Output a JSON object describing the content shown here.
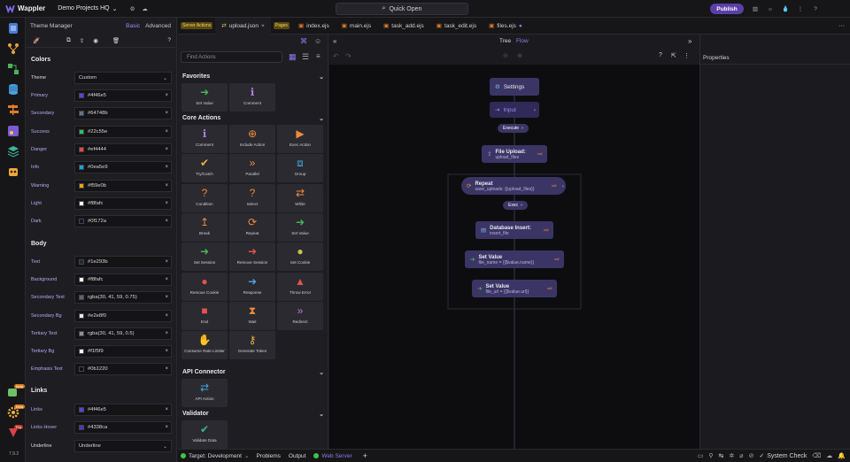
{
  "app": {
    "name": "Wappler",
    "project": "Demo Projects HQ",
    "quick_open": "Quick Open",
    "publish": "Publish",
    "version": "7.9.2"
  },
  "rail": {
    "badges": [
      "Beta",
      "Beta",
      "Pro"
    ]
  },
  "theme": {
    "title": "Theme Manager",
    "mode_basic": "Basic",
    "mode_advanced": "Advanced",
    "sections": {
      "colors": "Colors",
      "body": "Body",
      "links": "Links"
    },
    "theme_label": "Theme",
    "theme_value": "Custom",
    "colors": [
      {
        "label": "Primary",
        "value": "#4f46e5",
        "swatch": "#4f46e5"
      },
      {
        "label": "Secondary",
        "value": "#64748b",
        "swatch": "#64748b"
      },
      {
        "label": "Success",
        "value": "#22c55e",
        "swatch": "#22c55e"
      },
      {
        "label": "Danger",
        "value": "#ef4444",
        "swatch": "#ef4444"
      },
      {
        "label": "Info",
        "value": "#0ea5e9",
        "swatch": "#0ea5e9"
      },
      {
        "label": "Warning",
        "value": "#f59e0b",
        "swatch": "#f59e0b"
      },
      {
        "label": "Light",
        "value": "#f8fafc",
        "swatch": "#f8fafc"
      },
      {
        "label": "Dark",
        "value": "#0f172a",
        "swatch": "#0f172a"
      }
    ],
    "body": [
      {
        "label": "Text",
        "value": "#1e293b",
        "swatch": "#1e293b"
      },
      {
        "label": "Background",
        "value": "#f8fafc",
        "swatch": "#f8fafc"
      },
      {
        "label": "Secondary Text",
        "value": "rgba(30, 41, 59, 0.75)",
        "swatch": "#5b6478"
      },
      {
        "label": "Secondary Bg",
        "value": "#e2e8f0",
        "swatch": "#e2e8f0"
      },
      {
        "label": "Tertiary Text",
        "value": "rgba(30, 41, 59, 0.5)",
        "swatch": "#8a91a0"
      },
      {
        "label": "Tertiary Bg",
        "value": "#f1f5f9",
        "swatch": "#f1f5f9"
      },
      {
        "label": "Emphasis Text",
        "value": "#0b1220",
        "swatch": "#0b1220"
      }
    ],
    "links": [
      {
        "label": "Links",
        "value": "#4f46e5",
        "swatch": "#4f46e5"
      },
      {
        "label": "Links Hover",
        "value": "#4338ca",
        "swatch": "#4338ca"
      }
    ],
    "underline_label": "Underline",
    "underline_value": "Underline"
  },
  "tabs": [
    {
      "tag": "Server Actions",
      "label": ""
    },
    {
      "tag": "",
      "label": "upload.json"
    },
    {
      "tag": "Pages",
      "label": ""
    },
    {
      "tag": "",
      "label": "index.ejs"
    },
    {
      "tag": "",
      "label": "main.ejs"
    },
    {
      "tag": "",
      "label": "task_add.ejs"
    },
    {
      "tag": "",
      "label": "task_edit.ejs"
    },
    {
      "tag": "",
      "label": "files.ejs"
    }
  ],
  "actions": {
    "search_placeholder": "Find Actions",
    "groups": {
      "favorites": "Favorites",
      "core": "Core Actions",
      "api": "API Connector",
      "validator": "Validator"
    },
    "favorites": [
      "Set Value",
      "Comment"
    ],
    "core": [
      "Comment",
      "Include Action",
      "Exec Action",
      "Try/Catch",
      "Parallel",
      "Group",
      "Condition",
      "Select",
      "While",
      "Break",
      "Repeat",
      "Set Value",
      "Set Session",
      "Remove Session",
      "Set Cookie",
      "Remove Cookie",
      "Response",
      "Throw Error",
      "End",
      "Wait",
      "Redirect",
      "Consume Rate Limiter",
      "Generate Token"
    ],
    "api": [
      "API Action"
    ],
    "validator": [
      "Validate Data"
    ]
  },
  "canvas": {
    "view_tree": "Tree",
    "view_flow": "Flow",
    "settings": "Settings",
    "input": "Input",
    "execute": "Execute",
    "file_upload": {
      "title": "File Upload:",
      "sub": "upload_files"
    },
    "repeat": {
      "title": "Repeat",
      "sub": "save_uploads: {{upload_files}}"
    },
    "exec": "Exec",
    "db_insert": {
      "title": "Database Insert:",
      "sub": "insert_file"
    },
    "set1": {
      "title": "Set Value",
      "sub": "file_name = {{$value.name}}"
    },
    "set2": {
      "title": "Set Value",
      "sub": "file_url = {{$value.url}}"
    }
  },
  "props": {
    "title": "Properties"
  },
  "bottom": {
    "target": "Target: Development",
    "problems": "Problems",
    "output": "Output",
    "server": "Web Server",
    "system_check": "System Check"
  }
}
